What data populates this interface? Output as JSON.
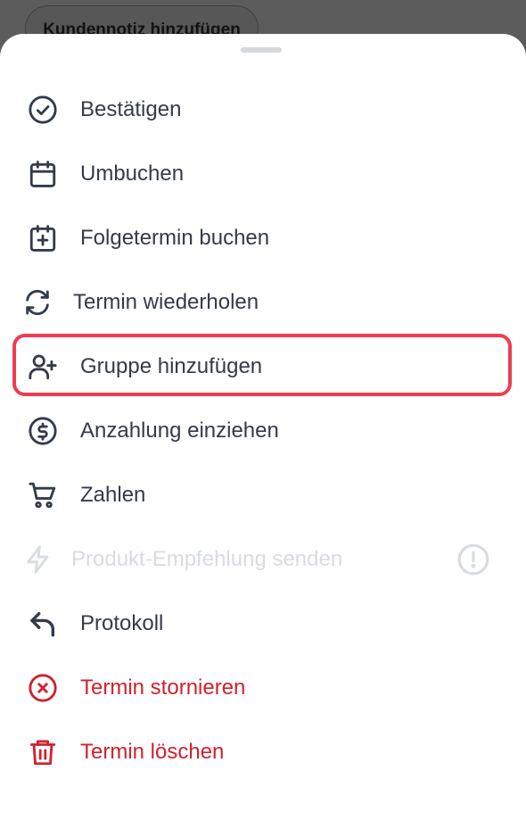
{
  "background": {
    "chip_label": "Kundennotiz hinzufügen"
  },
  "sheet": {
    "items": [
      {
        "label": "Bestätigen",
        "icon": "check-circle-icon"
      },
      {
        "label": "Umbuchen",
        "icon": "calendar-icon"
      },
      {
        "label": "Folgetermin buchen",
        "icon": "calendar-plus-icon"
      },
      {
        "label": "Termin wiederholen",
        "icon": "refresh-icon"
      },
      {
        "label": "Gruppe hinzufügen",
        "icon": "user-plus-icon",
        "highlighted": true
      },
      {
        "label": "Anzahlung einziehen",
        "icon": "dollar-circle-icon"
      },
      {
        "label": "Zahlen",
        "icon": "cart-icon"
      },
      {
        "label": "Produkt-Empfehlung senden",
        "icon": "lightning-icon",
        "disabled": true,
        "trailing_icon": "info-circle-icon"
      },
      {
        "label": "Protokoll",
        "icon": "undo-arrow-icon"
      },
      {
        "label": "Termin stornieren",
        "icon": "x-circle-icon",
        "danger": true
      },
      {
        "label": "Termin löschen",
        "icon": "trash-icon",
        "danger": true
      }
    ]
  },
  "colors": {
    "text": "#333b49",
    "danger": "#d0212e",
    "highlight": "#ee3d51",
    "disabled": "#d8dbe0"
  }
}
